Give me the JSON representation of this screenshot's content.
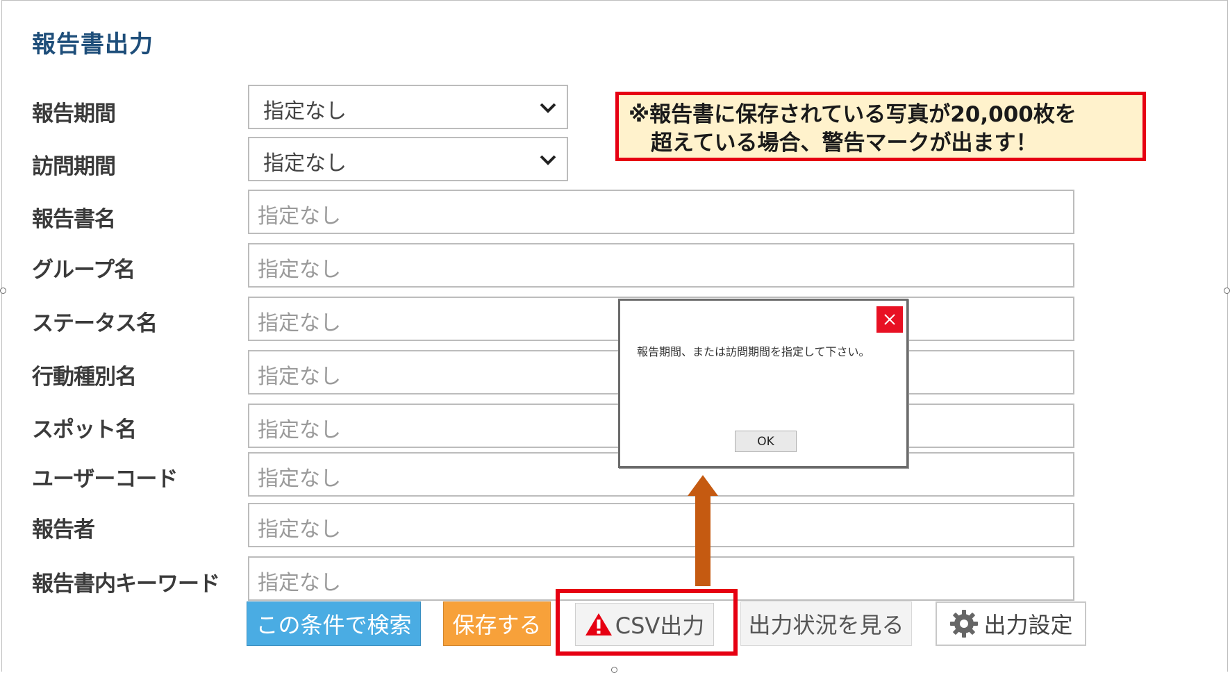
{
  "page": {
    "title": "報告書出力"
  },
  "fields": [
    {
      "label": "報告期間",
      "type": "select",
      "value": "指定なし"
    },
    {
      "label": "訪問期間",
      "type": "select",
      "value": "指定なし"
    },
    {
      "label": "報告書名",
      "type": "text",
      "placeholder": "指定なし"
    },
    {
      "label": "グループ名",
      "type": "text",
      "placeholder": "指定なし"
    },
    {
      "label": "ステータス名",
      "type": "text",
      "placeholder": "指定なし"
    },
    {
      "label": "行動種別名",
      "type": "text",
      "placeholder": "指定なし"
    },
    {
      "label": "スポット名",
      "type": "text",
      "placeholder": "指定なし"
    },
    {
      "label": "ユーザーコード",
      "type": "text",
      "placeholder": "指定なし"
    },
    {
      "label": "報告者",
      "type": "text",
      "placeholder": "指定なし"
    },
    {
      "label": "報告書内キーワード",
      "type": "text",
      "placeholder": "指定なし"
    }
  ],
  "buttons": {
    "search": "この条件で検索",
    "save": "保存する",
    "csv": "CSV出力",
    "status": "出力状況を見る",
    "settings": "出力設定"
  },
  "callout": {
    "line1": "※報告書に保存されている写真が20,000枚を",
    "line2": "超えている場合、警告マークが出ます！"
  },
  "dialog": {
    "message": "報告期間、または訪問期間を指定して下さい。",
    "ok_label": "OK"
  },
  "colors": {
    "title": "#1e4e7a",
    "search_button": "#4aace3",
    "save_button": "#f7a13a",
    "highlight": "#e60012",
    "callout_bg": "#fff2cc",
    "arrow": "#c55a11",
    "warning": "#e60012",
    "close_button": "#e81123"
  },
  "icons": {
    "select_chevron": "chevron-down-icon",
    "csv": "warning-icon",
    "settings": "gear-icon",
    "dialog_close": "close-icon"
  }
}
